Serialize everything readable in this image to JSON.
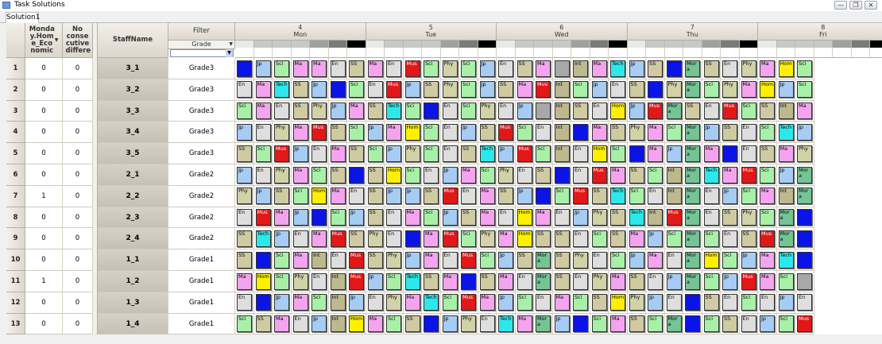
{
  "window": {
    "title": "Task Solutions",
    "buttons": {
      "minimize": "—",
      "restore": "❐",
      "close": "✕"
    }
  },
  "tabs": [
    {
      "label": "Solution1"
    }
  ],
  "headers": {
    "monday_home_economic": "Monda y.Hom e_Eco nomic",
    "no_consecutive": "No conse cutive differe",
    "staff_name": "StaffName",
    "filter": "Filter",
    "grade": "Grade"
  },
  "days": [
    {
      "num": "4",
      "name": "Mon"
    },
    {
      "num": "5",
      "name": "Tue"
    },
    {
      "num": "6",
      "name": "Wed"
    },
    {
      "num": "7",
      "name": "Thu"
    },
    {
      "num": "8",
      "name": "Fri"
    }
  ],
  "colors": {
    "Jp": "#a6ccf4",
    "En": "#dedede",
    "Sci": "#a8f0a8",
    "SS": "#cfcaa2",
    "Ma": "#f4a4ee",
    "Mus": "#e21818",
    "Phy": "#d2d2a8",
    "Tech": "#2de8ea",
    "Hom": "#fff000",
    "Int": "#bdb98e",
    "Mora": "#74c494",
    "blue": "#0a14e6",
    "grey": "#a8a8a8"
  },
  "period_header_pattern": [
    "#e9e9e9",
    "#c8c8c8",
    "#c8c8c8",
    "#c8c8c8",
    "#a0a0a0",
    "#7a7a7a",
    "#000000"
  ],
  "rows": [
    {
      "num": "1",
      "monday": "0",
      "nocons": "0",
      "staff": "3_1",
      "grade": "Grade3",
      "cells": [
        "blue",
        "Jp",
        "Sci",
        "Ma",
        "Ma",
        "En",
        "SS",
        "Ma",
        "En",
        "Mus",
        "Sci",
        "Phy",
        "Sci",
        "Jp",
        "En",
        "SS",
        "Ma",
        "grey",
        "Int",
        "Ma",
        "Tech",
        "Jp",
        "SS",
        "blue",
        "Mora",
        "SS",
        "En",
        "Phy",
        "Ma",
        "Hom",
        "Sci"
      ]
    },
    {
      "num": "2",
      "monday": "0",
      "nocons": "0",
      "staff": "3_2",
      "grade": "Grade3",
      "cells": [
        "En",
        "Ma",
        "Tech",
        "SS",
        "Jp",
        "blue",
        "Sci",
        "En",
        "Mus",
        "Jp",
        "SS",
        "Phy",
        "Sci",
        "Jp",
        "SS",
        "Ma",
        "Mus",
        "Int",
        "Sci",
        "Jp",
        "En",
        "SS",
        "blue",
        "Phy",
        "Mora",
        "Sci",
        "Phy",
        "Ma",
        "Hom",
        "Jp",
        "Sci"
      ]
    },
    {
      "num": "3",
      "monday": "0",
      "nocons": "0",
      "staff": "3_3",
      "grade": "Grade3",
      "cells": [
        "Sci",
        "Ma",
        "En",
        "SS",
        "Phy",
        "Jp",
        "Ma",
        "SS",
        "Tech",
        "Sci",
        "blue",
        "En",
        "Sci",
        "Phy",
        "En",
        "Jp",
        "grey",
        "Int",
        "SS",
        "En",
        "Hom",
        "Jp",
        "Mus",
        "Mora",
        "SS",
        "En",
        "Mus",
        "Sci",
        "SS",
        "Int",
        "Ma"
      ]
    },
    {
      "num": "4",
      "monday": "0",
      "nocons": "0",
      "staff": "3_4",
      "grade": "Grade3",
      "cells": [
        "Jp",
        "En",
        "Phy",
        "Ma",
        "Mus",
        "SS",
        "Sci",
        "Jp",
        "Ma",
        "Hom",
        "Sci",
        "En",
        "Jp",
        "SS",
        "Mus",
        "Sci",
        "En",
        "Int",
        "blue",
        "Ma",
        "SS",
        "Phy",
        "Ma",
        "Sci",
        "Mora",
        "Jp",
        "SS",
        "En",
        "Sci",
        "Tech",
        "Jp"
      ]
    },
    {
      "num": "5",
      "monday": "0",
      "nocons": "0",
      "staff": "3_5",
      "grade": "Grade3",
      "cells": [
        "SS",
        "Sci",
        "Mus",
        "Jp",
        "En",
        "Ma",
        "SS",
        "Sci",
        "Jp",
        "Phy",
        "Sci",
        "En",
        "SS",
        "Tech",
        "Jp",
        "Mus",
        "Sci",
        "Int",
        "En",
        "Hom",
        "Sci",
        "blue",
        "Ma",
        "Jp",
        "Mora",
        "Ma",
        "blue",
        "En",
        "SS",
        "Ma",
        "Phy"
      ]
    },
    {
      "num": "6",
      "monday": "0",
      "nocons": "0",
      "staff": "2_1",
      "grade": "Grade2",
      "cells": [
        "Jp",
        "En",
        "Phy",
        "Ma",
        "Sci",
        "SS",
        "blue",
        "SS",
        "Hom",
        "Sci",
        "En",
        "Jp",
        "Ma",
        "Sci",
        "Phy",
        "En",
        "SS",
        "blue",
        "En",
        "Mus",
        "Ma",
        "SS",
        "Sci",
        "Int",
        "Mora",
        "Tech",
        "Ma",
        "Mus",
        "Sci",
        "Jp",
        "Mora"
      ]
    },
    {
      "num": "7",
      "monday": "1",
      "nocons": "0",
      "staff": "2_2",
      "grade": "Grade2",
      "cells": [
        "Phy",
        "Jp",
        "SS",
        "Sci",
        "Hom",
        "Ma",
        "En",
        "SS",
        "Jp",
        "Jp",
        "SS",
        "Mus",
        "En",
        "Ma",
        "SS",
        "Jp",
        "blue",
        "Sci",
        "Mus",
        "SS",
        "Tech",
        "Sci",
        "En",
        "Int",
        "Mora",
        "En",
        "Jp",
        "Sci",
        "Ma",
        "Int",
        "Mora"
      ]
    },
    {
      "num": "8",
      "monday": "0",
      "nocons": "0",
      "staff": "2_3",
      "grade": "Grade2",
      "cells": [
        "En",
        "Mus",
        "Ma",
        "Jp",
        "blue",
        "Sci",
        "Jp",
        "SS",
        "En",
        "Ma",
        "Sci",
        "Jp",
        "SS",
        "Ma",
        "En",
        "Hom",
        "Ma",
        "En",
        "Jp",
        "Phy",
        "SS",
        "Tech",
        "Int",
        "Mus",
        "Mora",
        "En",
        "SS",
        "Phy",
        "Sci",
        "Mora",
        "blue"
      ]
    },
    {
      "num": "9",
      "monday": "0",
      "nocons": "0",
      "staff": "2_4",
      "grade": "Grade2",
      "cells": [
        "SS",
        "Tech",
        "Jp",
        "En",
        "Ma",
        "Mus",
        "SS",
        "Phy",
        "En",
        "blue",
        "Ma",
        "Mus",
        "Sci",
        "Phy",
        "Ma",
        "Hom",
        "SS",
        "SS",
        "En",
        "Sci",
        "SS",
        "Ma",
        "Jp",
        "Sci",
        "Mora",
        "Sci",
        "En",
        "SS",
        "Mus",
        "Mora",
        "blue"
      ]
    },
    {
      "num": "10",
      "monday": "0",
      "nocons": "0",
      "staff": "1_1",
      "grade": "Grade1",
      "cells": [
        "SS",
        "blue",
        "Sci",
        "Ma",
        "Int",
        "En",
        "Mus",
        "SS",
        "Phy",
        "Jp",
        "Ma",
        "En",
        "Mus",
        "Sci",
        "Jp",
        "SS",
        "Mora",
        "SS",
        "Phy",
        "En",
        "Sci",
        "Jp",
        "Ma",
        "En",
        "Mora",
        "Hom",
        "Sci",
        "Jp",
        "Ma",
        "Tech",
        "blue"
      ]
    },
    {
      "num": "11",
      "monday": "1",
      "nocons": "0",
      "staff": "1_2",
      "grade": "Grade1",
      "cells": [
        "Ma",
        "Hom",
        "Sci",
        "Phy",
        "En",
        "Int",
        "Mus",
        "Jp",
        "Sci",
        "Tech",
        "SS",
        "Ma",
        "blue",
        "SS",
        "Ma",
        "En",
        "Mora",
        "SS",
        "En",
        "Phy",
        "Ma",
        "SS",
        "En",
        "Jp",
        "Mora",
        "Sci",
        "Jp",
        "Mus",
        "Ma",
        "Sci",
        "grey"
      ]
    },
    {
      "num": "12",
      "monday": "0",
      "nocons": "0",
      "staff": "1_3",
      "grade": "Grade1",
      "cells": [
        "En",
        "blue",
        "Jp",
        "Ma",
        "Sci",
        "Int",
        "Jp",
        "En",
        "Phy",
        "Ma",
        "Tech",
        "Sci",
        "Mus",
        "Ma",
        "Jp",
        "Sci",
        "En",
        "Ma",
        "Sci",
        "SS",
        "Hom",
        "Phy",
        "Jp",
        "En",
        "blue",
        "SS",
        "En",
        "Sci",
        "En",
        "Jp",
        "En"
      ]
    },
    {
      "num": "13",
      "monday": "0",
      "nocons": "0",
      "staff": "1_4",
      "grade": "Grade1",
      "cells": [
        "Sci",
        "SS",
        "Ma",
        "En",
        "Jp",
        "Int",
        "Hom",
        "Ma",
        "Sci",
        "SS",
        "blue",
        "Jp",
        "Phy",
        "En",
        "Tech",
        "Ma",
        "Mora",
        "Jp",
        "blue",
        "Sci",
        "Ma",
        "SS",
        "Sci",
        "Mora",
        "blue",
        "Sci",
        "SS",
        "En",
        "Jp",
        "Sci",
        "Mus"
      ]
    }
  ]
}
